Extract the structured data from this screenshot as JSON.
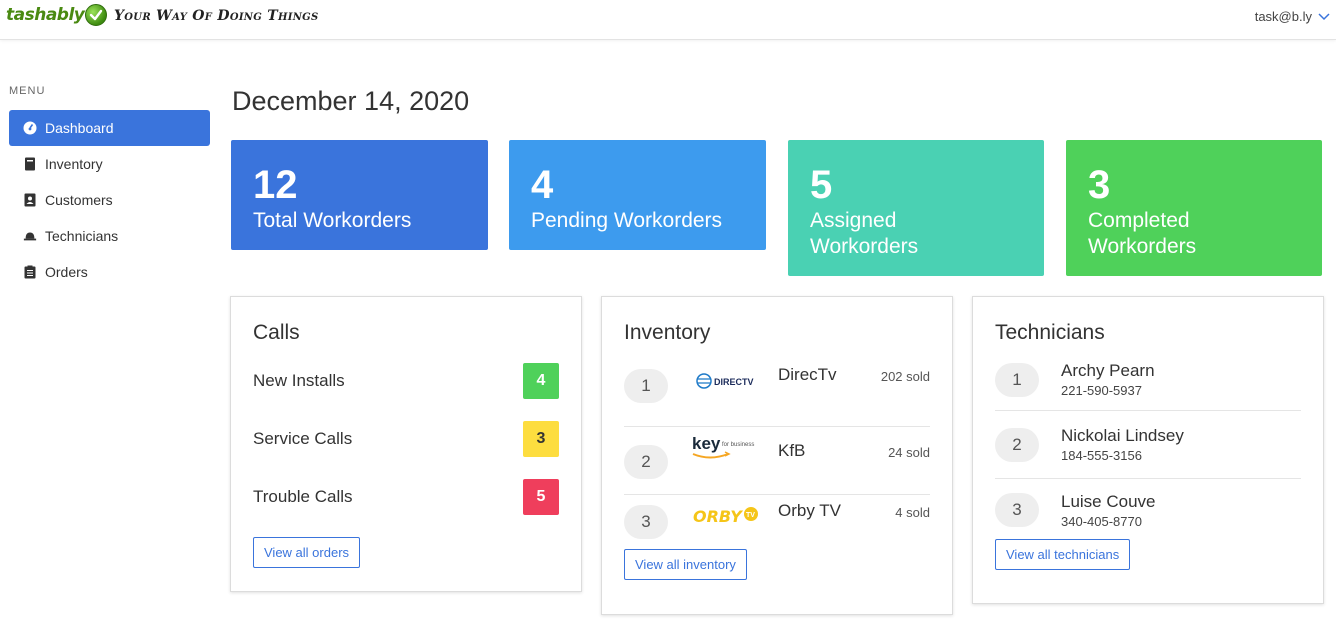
{
  "header": {
    "logo_text": "tashably",
    "tagline": "Your Way Of Doing Things",
    "user_email": "task@b.ly"
  },
  "sidebar": {
    "menu_title": "MENU",
    "items": [
      {
        "label": "Dashboard",
        "icon": "dashboard-icon",
        "active": true
      },
      {
        "label": "Inventory",
        "icon": "book-icon",
        "active": false
      },
      {
        "label": "Customers",
        "icon": "contact-card-icon",
        "active": false
      },
      {
        "label": "Technicians",
        "icon": "hard-hat-icon",
        "active": false
      },
      {
        "label": "Orders",
        "icon": "clipboard-icon",
        "active": false
      }
    ]
  },
  "main": {
    "date": "December 14, 2020",
    "stats": [
      {
        "value": "12",
        "label": "Total Workorders",
        "color": "#3a74dc"
      },
      {
        "value": "4",
        "label": "Pending Workorders",
        "color": "#3d9bee"
      },
      {
        "value": "5",
        "label": "Assigned Workorders",
        "color": "#4ad1b3"
      },
      {
        "value": "3",
        "label": "Completed Workorders",
        "color": "#4fd15a"
      }
    ],
    "calls": {
      "title": "Calls",
      "rows": [
        {
          "label": "New Installs",
          "count": "4",
          "color": "#4fd15a"
        },
        {
          "label": "Service Calls",
          "count": "3",
          "color": "#fddd3f"
        },
        {
          "label": "Trouble Calls",
          "count": "5",
          "color": "#ef3e5c"
        }
      ],
      "button": "View all orders"
    },
    "inventory": {
      "title": "Inventory",
      "rows": [
        {
          "rank": "1",
          "name": "DirecTv",
          "sold": "202 sold",
          "logo": "directv-logo",
          "logo_text": "DIRECTV"
        },
        {
          "rank": "2",
          "name": "KfB",
          "sold": "24 sold",
          "logo": "key-for-business-logo",
          "logo_text": "key",
          "logo_sub": "for business"
        },
        {
          "rank": "3",
          "name": "Orby TV",
          "sold": "4 sold",
          "logo": "orby-tv-logo",
          "logo_text": "ORBY",
          "logo_sub": "TV"
        }
      ],
      "button": "View all inventory"
    },
    "technicians": {
      "title": "Technicians",
      "rows": [
        {
          "rank": "1",
          "name": "Archy Pearn",
          "phone": "221-590-5937"
        },
        {
          "rank": "2",
          "name": "Nickolai Lindsey",
          "phone": "184-555-3156"
        },
        {
          "rank": "3",
          "name": "Luise Couve",
          "phone": "340-405-8770"
        }
      ],
      "button": "View all technicians"
    }
  }
}
